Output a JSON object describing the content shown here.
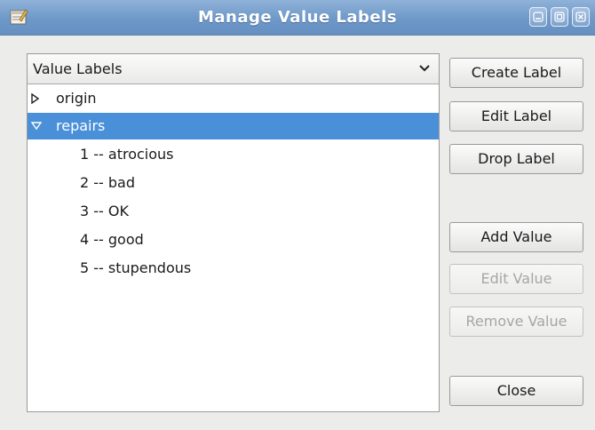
{
  "window": {
    "title": "Manage Value Labels",
    "controls": [
      "minimize-icon",
      "maximize-icon",
      "close-icon"
    ]
  },
  "selector": {
    "selected": "Value Labels"
  },
  "tree": {
    "items": [
      {
        "label": "origin",
        "expanded": false,
        "selected": false
      },
      {
        "label": "repairs",
        "expanded": true,
        "selected": true,
        "children": [
          "1 -- atrocious",
          "2 -- bad",
          "3 -- OK",
          "4 -- good",
          "5 -- stupendous"
        ]
      }
    ]
  },
  "buttons": {
    "create_label": "Create Label",
    "edit_label": "Edit Label",
    "drop_label": "Drop Label",
    "add_value": "Add Value",
    "edit_value": "Edit Value",
    "remove_value": "Remove Value",
    "close": "Close"
  },
  "colors": {
    "titlebar": "#6d98c8",
    "selection": "#4a90d9",
    "disabled_text": "#a6a6a6"
  }
}
